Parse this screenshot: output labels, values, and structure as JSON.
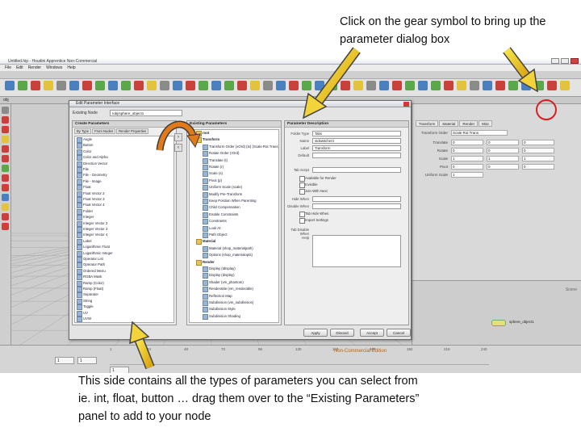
{
  "captions": {
    "top": "Click on the gear symbol to bring up the parameter dialog box",
    "bottom": "This side contains all the types of parameters you can select from ie. int, float, button … drag them over to the “Existing Parameters” panel to add to your node"
  },
  "app": {
    "title": "Untitled.hip - Houdini Apprentice Non-Commercial",
    "menu": [
      "File",
      "Edit",
      "Render",
      "Windows",
      "Help"
    ],
    "network_path": "obj",
    "node_label": "sphere_object1",
    "viewport_label": "Scene",
    "watermark": "Non-Commercial Edition",
    "param_tabs": [
      "Transform",
      "Material",
      "Render",
      "Misc"
    ],
    "param_rows": [
      {
        "label": "Transform Order",
        "value": "Scale Rot Trans"
      },
      {
        "label": "Translate",
        "value": "0"
      },
      {
        "label": "Rotate",
        "value": "0"
      },
      {
        "label": "Scale",
        "value": "1"
      },
      {
        "label": "Pivot",
        "value": "0"
      },
      {
        "label": "Uniform Scale",
        "value": "1"
      }
    ],
    "timeline": {
      "start": "1",
      "end": "1",
      "frame": "1",
      "ticks": [
        "1",
        "24",
        "48",
        "72",
        "96",
        "120",
        "144",
        "168",
        "192",
        "216",
        "240"
      ]
    },
    "icon_colors": {
      "red": "#c9413a",
      "green": "#5aa84a",
      "blue": "#4a7fc0",
      "yellow": "#e3c23c",
      "gray": "#8b8b8b"
    }
  },
  "dialog": {
    "title": "Edit Parameter Interface",
    "node_label": "Existing Node",
    "node_value": "/obj/sphere_object1",
    "create_panel": {
      "header": "Create Parameters",
      "tabs": [
        "By Type",
        "From Nodes",
        "Render Properties"
      ],
      "items": [
        "Angle",
        "Button",
        "Color",
        "Color and Alpha",
        "Direction Vector",
        "File",
        "File - Geometry",
        "File - Image",
        "Float",
        "Float Vector 2",
        "Float Vector 3",
        "Float Vector 4",
        "Folder",
        "Integer",
        "Integer Vector 2",
        "Integer Vector 3",
        "Integer Vector 4",
        "Label",
        "Logarithmic Float",
        "Logarithmic Integer",
        "Operator List",
        "Operator Path",
        "Ordered Menu",
        "RGBA Mask",
        "Ramp (Color)",
        "Ramp (Float)",
        "Separator",
        "String",
        "Toggle",
        "UV",
        "UVW"
      ]
    },
    "existing_panel": {
      "header": "Existing Parameters",
      "tree": [
        {
          "kind": "folder",
          "text": "root"
        },
        {
          "kind": "folder",
          "text": "Transform"
        },
        {
          "kind": "sub",
          "text": "Transform Order (xOrd) (tx) (Scale Rot Trans)"
        },
        {
          "kind": "sub",
          "text": "Rotate Order (rOrd)"
        },
        {
          "kind": "sub",
          "text": "Translate (t)"
        },
        {
          "kind": "sub",
          "text": "Rotate (r)"
        },
        {
          "kind": "sub",
          "text": "Scale (s)"
        },
        {
          "kind": "sub",
          "text": "Pivot (p)"
        },
        {
          "kind": "sub",
          "text": "Uniform Scale (scale)"
        },
        {
          "kind": "sub",
          "text": "Modify Pre-Transform"
        },
        {
          "kind": "sub",
          "text": "Keep Position When Parenting"
        },
        {
          "kind": "sub",
          "text": "Child Compensation"
        },
        {
          "kind": "sub",
          "text": "Enable Constraints"
        },
        {
          "kind": "sub",
          "text": "Constraints"
        },
        {
          "kind": "sub",
          "text": "Look At"
        },
        {
          "kind": "sub",
          "text": "Path Object"
        },
        {
          "kind": "folder",
          "text": "Material"
        },
        {
          "kind": "sub",
          "text": "Material (shop_materialpath)"
        },
        {
          "kind": "sub",
          "text": "Options (shop_materialopts)"
        },
        {
          "kind": "folder",
          "text": "Render"
        },
        {
          "kind": "sub",
          "text": "Display (tdisplay)"
        },
        {
          "kind": "sub",
          "text": "Display (display)"
        },
        {
          "kind": "sub",
          "text": "Shader (vm_phantom)"
        },
        {
          "kind": "sub",
          "text": "Renderable (vm_renderable)"
        },
        {
          "kind": "sub",
          "text": "Reflection Map"
        },
        {
          "kind": "sub",
          "text": "Subdivision (vm_subdivision)"
        },
        {
          "kind": "sub",
          "text": "Subdivision Style"
        },
        {
          "kind": "sub",
          "text": "Subdivision Shading"
        }
      ]
    },
    "description_panel": {
      "header": "Parameter Description",
      "fields": [
        {
          "label": "Folder Type",
          "value": "Tabs"
        },
        {
          "label": "Name",
          "value": "stdswitcher3"
        },
        {
          "label": "Label",
          "value": "Transform"
        },
        {
          "label": "Default",
          "value": ""
        },
        {
          "label": "Tab Script",
          "value": ""
        }
      ],
      "checks": [
        "Available for Render",
        "Invisible",
        "Join With Next",
        "Tab Hide When",
        "Import Settings"
      ],
      "extra_labels": [
        "Hide When",
        "Disable When",
        "Tab Disable When",
        "Help"
      ]
    },
    "buttons": [
      "Apply",
      "Discard",
      "Accept",
      "Cancel"
    ]
  }
}
